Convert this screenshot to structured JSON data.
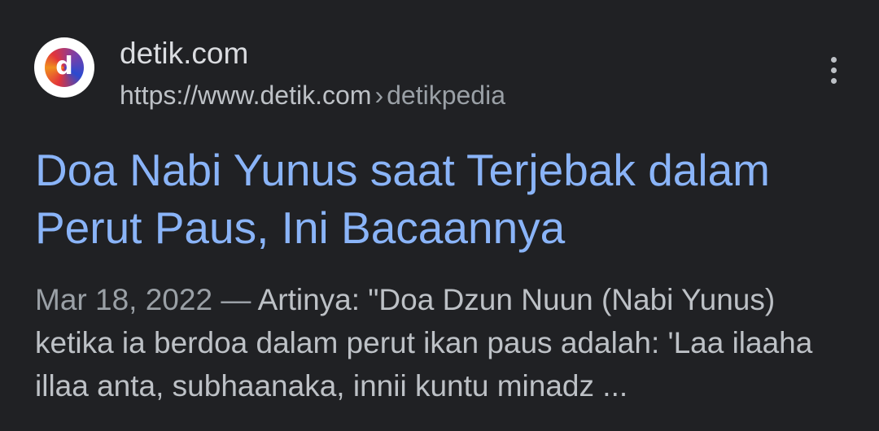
{
  "result": {
    "favicon_letter": "d",
    "favicon_icon": "detik-logo-icon",
    "site_name": "detik.com",
    "url": "https://www.detik.com",
    "url_separator": "›",
    "breadcrumb": "detikpedia",
    "more_icon": "more-vert-icon",
    "title": "Doa Nabi Yunus saat Terjebak dalam Perut Paus, Ini Bacaannya",
    "date": "Mar 18, 2022",
    "dash": "—",
    "snippet": "Artinya: \"Doa Dzun Nuun (Nabi Yunus) ketika ia berdoa dalam perut ikan paus adalah: 'Laa ilaaha illaa anta, subhaanaka, innii kuntu minadz ..."
  },
  "colors": {
    "background": "#202124",
    "title_link": "#8ab4f8",
    "text": "#bdc1c6",
    "muted": "#9aa0a6"
  }
}
